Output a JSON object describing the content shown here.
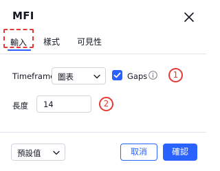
{
  "dialog": {
    "title": "MFI"
  },
  "tabs": [
    {
      "label": "輸入",
      "active": true
    },
    {
      "label": "樣式",
      "active": false
    },
    {
      "label": "可見性",
      "active": false
    }
  ],
  "inputs": {
    "timeframe": {
      "label": "Timeframe",
      "value": "圖表"
    },
    "gaps": {
      "label": "Gaps",
      "checked": true
    },
    "length": {
      "label": "長度",
      "value": "14"
    }
  },
  "annotations": {
    "badge_1": "1",
    "badge_2": "2"
  },
  "footer": {
    "defaults_label": "預設值",
    "cancel_label": "取消",
    "ok_label": "確認"
  },
  "colors": {
    "accent": "#2962ff",
    "annotation": "#e53935",
    "border": "#d1d4dc",
    "text": "#131722"
  }
}
